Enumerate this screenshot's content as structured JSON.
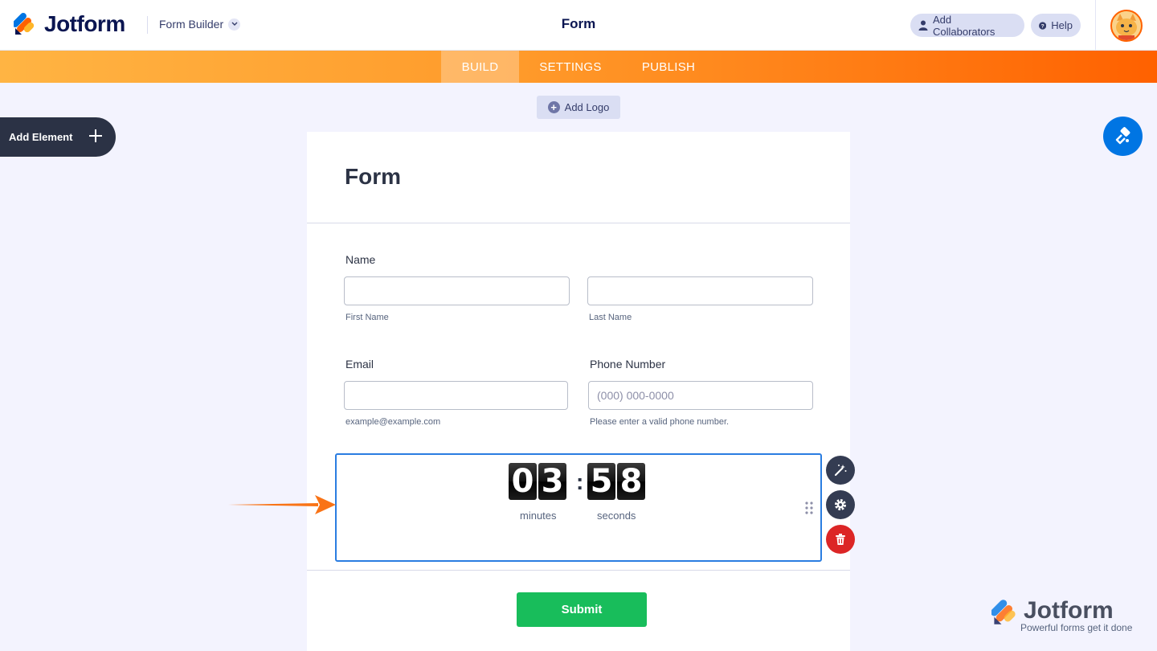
{
  "header": {
    "logo_text": "Jotform",
    "builder_label": "Form Builder",
    "page_title": "Form",
    "add_collaborators_label": "Add Collaborators",
    "help_label": "Help"
  },
  "nav": {
    "tabs": [
      {
        "label": "BUILD",
        "active": true
      },
      {
        "label": "SETTINGS",
        "active": false
      },
      {
        "label": "PUBLISH",
        "active": false
      }
    ]
  },
  "toolbar": {
    "add_logo_label": "Add Logo",
    "add_element_label": "Add Element"
  },
  "form": {
    "title": "Form",
    "name_label": "Name",
    "first_name_sublabel": "First Name",
    "last_name_sublabel": "Last Name",
    "email_label": "Email",
    "email_sublabel": "example@example.com",
    "phone_label": "Phone Number",
    "phone_placeholder": "(000) 000-0000",
    "phone_sublabel": "Please enter a valid phone number.",
    "timer": {
      "minutes": [
        "0",
        "3"
      ],
      "seconds": [
        "5",
        "8"
      ],
      "separator": ":",
      "minutes_label": "minutes",
      "seconds_label": "seconds"
    },
    "submit_label": "Submit"
  },
  "watermark": {
    "brand": "Jotform",
    "tagline": "Powerful forms get it done"
  },
  "colors": {
    "accent_orange": "#ff6100",
    "accent_blue": "#0075e3",
    "submit_green": "#18bd5b",
    "delete_red": "#dc2626"
  }
}
